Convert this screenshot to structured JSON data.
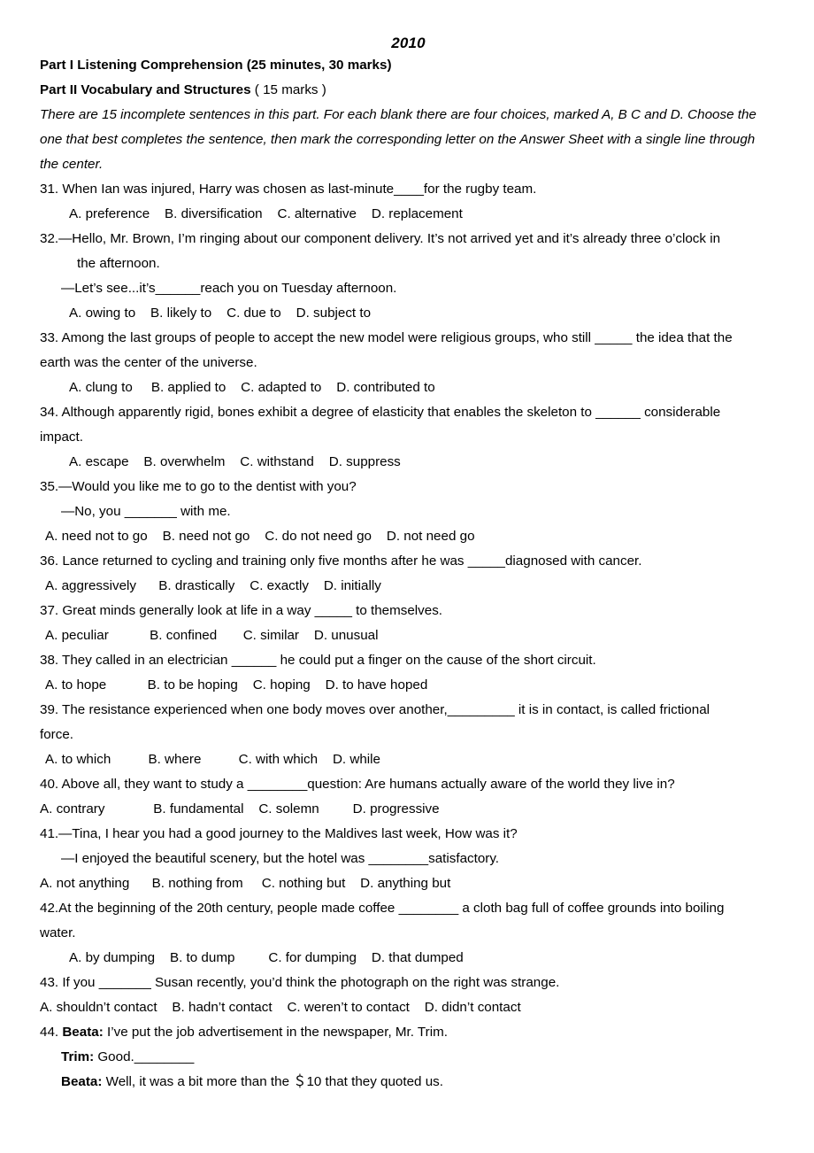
{
  "document": {
    "title": "2010",
    "header_lines": [
      {
        "bold_part": "Part I Listening Comprehension (25 minutes, 30 marks)",
        "normal_part": ""
      },
      {
        "bold_part": "Part II Vocabulary and Structures",
        "normal_part": " ( 15 marks )"
      }
    ],
    "directions": "There are 15 incomplete sentences in this part. For each blank there are four choices, marked A, B C and D. Choose the one that best completes the sentence, then mark the corresponding letter on the Answer Sheet with a single line through the center.",
    "questions": [
      {
        "number": "31",
        "stem": "31. When Ian was injured, Harry was chosen as last-minute____for the rugby team.",
        "options": "A. preference    B. diversification    C. alternative    D. replacement"
      },
      {
        "number": "32",
        "stem_line1": "32.—Hello, Mr. Brown, I’m ringing about our component delivery. It’s not arrived yet and it’s already three o’clock in",
        "stem_line2": "the afternoon.",
        "stem_line3": "—Let’s see...it’s______reach you on Tuesday afternoon.",
        "options": "A. owing to    B. likely to    C. due to    D. subject to"
      },
      {
        "number": "33",
        "stem_line1": "33. Among the last groups of people to accept the new model were religious groups, who still  _____  the idea that the",
        "stem_line2": "earth was the center of the universe.",
        "options": "A. clung to     B. applied to    C. adapted to    D. contributed to"
      },
      {
        "number": "34",
        "stem_line1": "34. Although apparently rigid, bones exhibit a degree of elasticity that enables the skeleton to  ______  considerable",
        "stem_line2": "impact.",
        "options": "A. escape    B. overwhelm    C. withstand    D. suppress"
      },
      {
        "number": "35",
        "stem_line1": "35.—Would you like me to go to the dentist with you?",
        "stem_line2": "—No, you _______ with me.",
        "options": "A. need not to go    B. need not go    C. do not need go    D. not need go"
      },
      {
        "number": "36",
        "stem": "36. Lance returned to cycling and training only five months after he was  _____diagnosed with cancer.",
        "options": "A. aggressively      B. drastically    C. exactly    D. initially"
      },
      {
        "number": "37",
        "stem": "37. Great minds generally look at life in a way  _____  to themselves.",
        "options": "A. peculiar           B. confined       C. similar    D. unusual"
      },
      {
        "number": "38",
        "stem": "38. They called in an electrician  ______  he could put a finger on the cause of the short circuit.",
        "options": "A. to hope           B. to be hoping    C. hoping    D. to have hoped"
      },
      {
        "number": "39",
        "stem_line1": "39. The resistance experienced when one body moves over another,_________  it is in contact, is called frictional",
        "stem_line2": "force.",
        "options": "A. to which          B. where          C. with which    D. while"
      },
      {
        "number": "40",
        "stem": "40. Above all, they want to study a  ________question: Are humans actually aware of the world they live in?",
        "options": "A. contrary             B. fundamental    C. solemn         D. progressive"
      },
      {
        "number": "41",
        "stem_line1": "41.—Tina, I hear you had a good journey to the Maldives last week, How was it?",
        "stem_line2": "—I enjoyed the beautiful scenery, but the hotel was  ________satisfactory.",
        "options": "A. not anything      B. nothing from     C. nothing but    D. anything but"
      },
      {
        "number": "42",
        "stem_line1": "42.At the beginning of the 20th century, people made coffee  ________  a cloth bag full of coffee grounds into boiling",
        "stem_line2": "water.",
        "options": "A. by dumping    B. to dump         C. for dumping    D. that dumped"
      },
      {
        "number": "43",
        "stem": "43. If you _______  Susan recently, you’d think the photograph on the right was strange.",
        "options": "A. shouldn’t contact    B. hadn’t contact    C. weren’t to contact    D. didn’t contact"
      },
      {
        "number": "44",
        "dialogue": [
          {
            "prefix": "44. ",
            "speaker": "Beata:",
            "text": " I’ve put the job advertisement in the newspaper, Mr. Trim."
          },
          {
            "prefix": "",
            "speaker": "Trim:",
            "text": " Good.________"
          },
          {
            "prefix": "",
            "speaker": "Beata:",
            "text": " Well, it was a bit more than the  ＄10 that they quoted us."
          }
        ]
      }
    ]
  }
}
